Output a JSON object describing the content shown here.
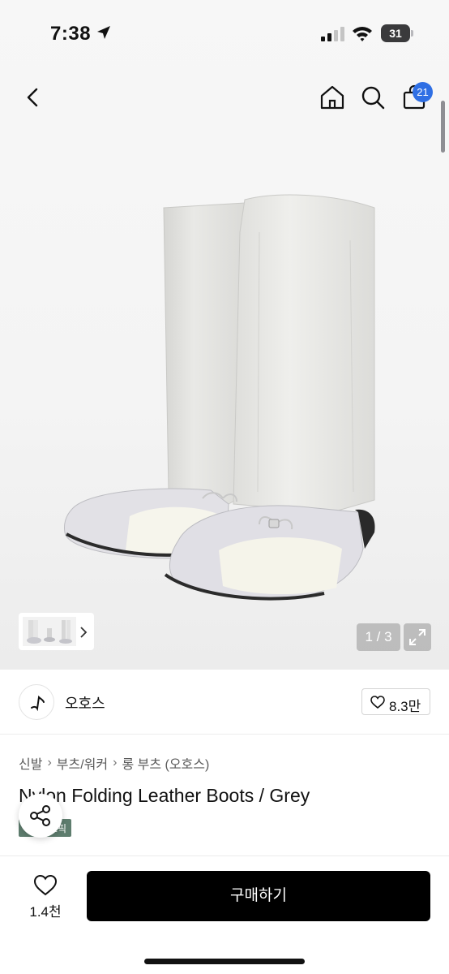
{
  "status_bar": {
    "time": "7:38",
    "battery": "31"
  },
  "nav": {
    "cart_count": "21"
  },
  "gallery": {
    "pager": "1 / 3"
  },
  "brand": {
    "name": "오호스",
    "likes": "8.3만"
  },
  "breadcrumb": [
    "신발",
    "부츠/워커",
    "롱 부츠 (오호스)"
  ],
  "product": {
    "title": "Nylon Folding Leather Boots / Grey",
    "tag": "브랜드픽"
  },
  "bottom_bar": {
    "wish_count": "1.4천",
    "buy_label": "구매하기"
  },
  "colors": {
    "accent_badge": "#2f6fe4",
    "buy_button": "#000000",
    "tag": "#5e7d6e"
  }
}
